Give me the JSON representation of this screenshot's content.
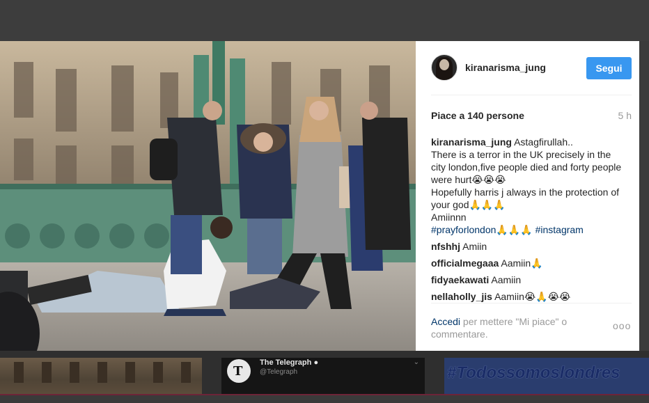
{
  "post": {
    "username": "kiranarisma_jung",
    "follow_label": "Segui",
    "likes_text": "Piace a 140 persone",
    "age": "5 h",
    "caption": {
      "user": "kiranarisma_jung",
      "text": "Astagfirullah..\nThere is a terror in the UK precisely in the city london,five people died and forty people were hurt😭😭😭\nHopefully harris j always in the protection of your god🙏🙏🙏\nAmiinnn\n",
      "hashtags": [
        "#prayforlondon🙏🙏🙏",
        "#instagram"
      ]
    },
    "comments": [
      {
        "user": "nfshhj",
        "text": "Amiin"
      },
      {
        "user": "officialmegaaa",
        "text": "Aamiin🙏"
      },
      {
        "user": "fidyaekawati",
        "text": "Aamiin"
      },
      {
        "user": "nellaholly_jis",
        "text": "Aamiin😭🙏😭😭"
      }
    ],
    "footer": {
      "login_link": "Accedi",
      "login_text": " per mettere \"Mi piace\" o commentare.",
      "more_label": "ooo"
    }
  },
  "thumbnails": {
    "telegraph_name": "The Telegraph",
    "telegraph_handle": "@Telegraph",
    "telegraph_logo_letter": "T",
    "hashtag_banner": "#Todossomoslondres"
  },
  "colors": {
    "accent": "#3897f0",
    "link": "#003569",
    "text": "#262626",
    "muted": "#999999",
    "backdrop": "#3b3b3b"
  },
  "icons": {
    "verified": "check-circle-icon",
    "more": "ellipsis-icon",
    "chevron": "chevron-down-icon"
  }
}
